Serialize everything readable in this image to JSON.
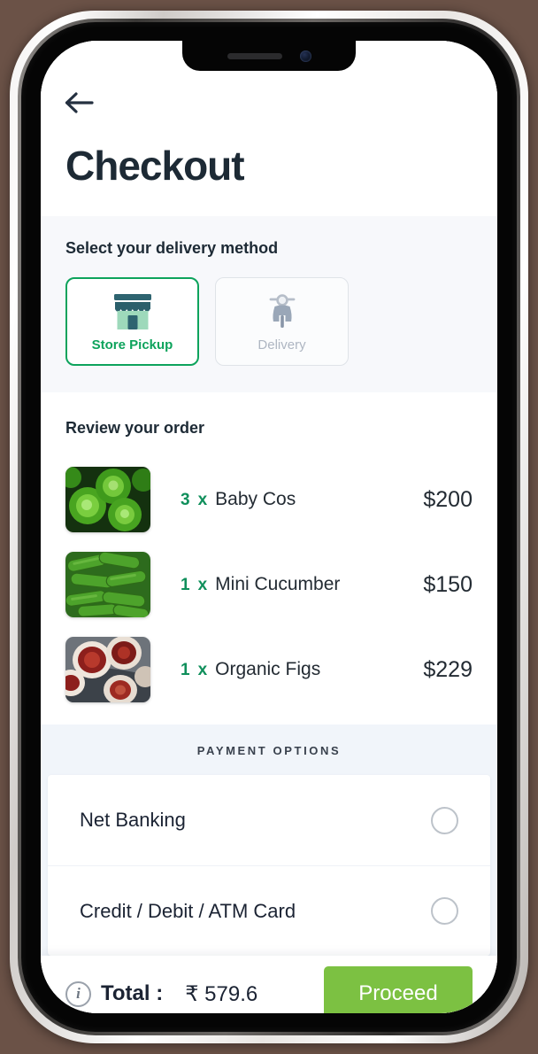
{
  "header": {
    "back_icon": "arrow-left-icon",
    "title": "Checkout"
  },
  "delivery": {
    "section_label": "Select your delivery method",
    "options": [
      {
        "label": "Store Pickup",
        "icon": "store-icon",
        "selected": true
      },
      {
        "label": "Delivery",
        "icon": "scooter-icon",
        "selected": false
      }
    ],
    "selected_border_color": "#0da35c"
  },
  "order": {
    "section_label": "Review your order",
    "items": [
      {
        "qty": "3",
        "multiplier": "x",
        "name": "Baby Cos",
        "price": "$200",
        "image": "lettuce-thumbnail"
      },
      {
        "qty": "1",
        "multiplier": "x",
        "name": "Mini Cucumber",
        "price": "$150",
        "image": "cucumber-thumbnail"
      },
      {
        "qty": "1",
        "multiplier": "x",
        "name": "Organic Figs",
        "price": "$229",
        "image": "figs-thumbnail"
      }
    ],
    "qty_color": "#0f8f5b"
  },
  "payment": {
    "title": "PAYMENT OPTIONS",
    "options": [
      {
        "label": "Net Banking",
        "selected": false
      },
      {
        "label": "Credit / Debit / ATM Card",
        "selected": false
      }
    ]
  },
  "footer": {
    "info_icon": "info-icon",
    "info_glyph": "i",
    "total_label": "Total :",
    "total_value": "₹ 579.6",
    "proceed_label": "Proceed",
    "proceed_color": "#7cc142"
  }
}
